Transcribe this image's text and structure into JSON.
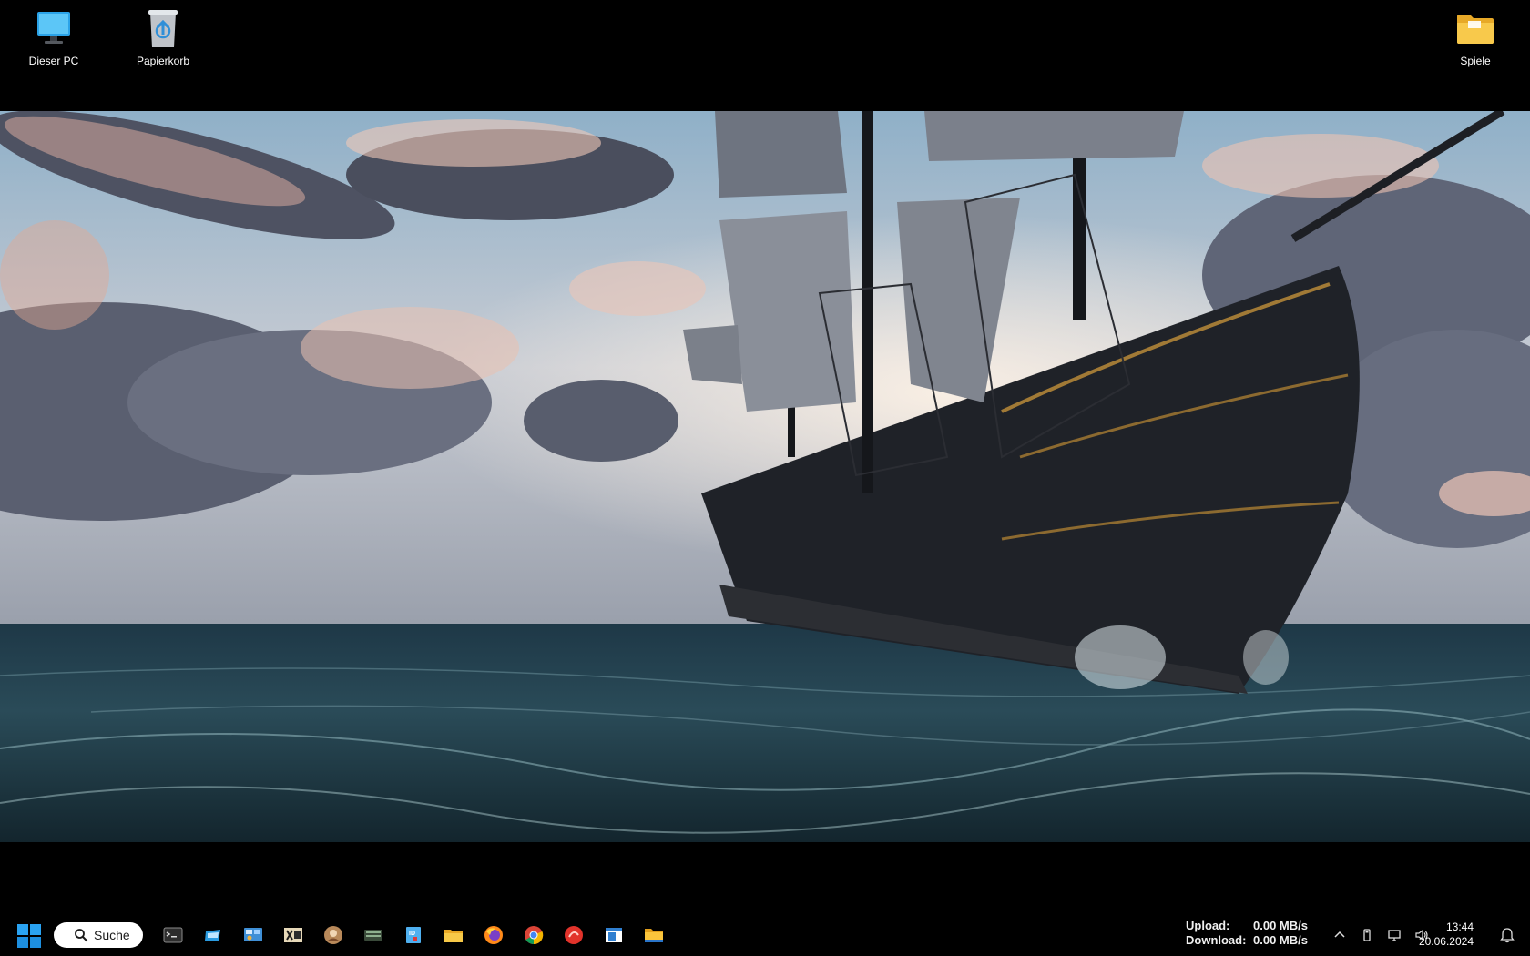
{
  "desktop": {
    "icons": [
      {
        "label": "Dieser PC",
        "icon": "this-pc-icon"
      },
      {
        "label": "Papierkorb",
        "icon": "recycle-bin-icon"
      },
      {
        "label": "Spiele",
        "icon": "folder-icon"
      }
    ],
    "wallpaper": {
      "subject": "pirate-ship-wallpaper"
    }
  },
  "taskbar": {
    "search_label": "Suche",
    "apps": [
      {
        "name": "terminal",
        "icon": "terminal-icon"
      },
      {
        "name": "app",
        "icon": "app-blue-icon"
      },
      {
        "name": "control-panel",
        "icon": "control-panel-icon"
      },
      {
        "name": "xd-app",
        "icon": "xd-app-icon"
      },
      {
        "name": "app-avatar",
        "icon": "app-round-icon"
      },
      {
        "name": "keyboard-app",
        "icon": "keyboard-app-icon"
      },
      {
        "name": "id-app",
        "icon": "id-app-icon"
      },
      {
        "name": "file-explorer",
        "icon": "file-explorer-icon"
      },
      {
        "name": "firefox",
        "icon": "firefox-icon"
      },
      {
        "name": "chrome",
        "icon": "chrome-icon"
      },
      {
        "name": "red-app",
        "icon": "red-circle-app-icon"
      },
      {
        "name": "window-app",
        "icon": "window-app-icon"
      },
      {
        "name": "folder-app",
        "icon": "yellow-folder-app-icon"
      }
    ],
    "network": {
      "upload_label": "Upload:",
      "upload_value": "0.00 MB/s",
      "download_label": "Download:",
      "download_value": "0.00 MB/s"
    },
    "clock": {
      "time": "13:44",
      "date": "20.06.2024"
    }
  },
  "colors": {
    "accent": "#0078d4",
    "folder": "#f5c342",
    "taskbar": "#000000"
  }
}
